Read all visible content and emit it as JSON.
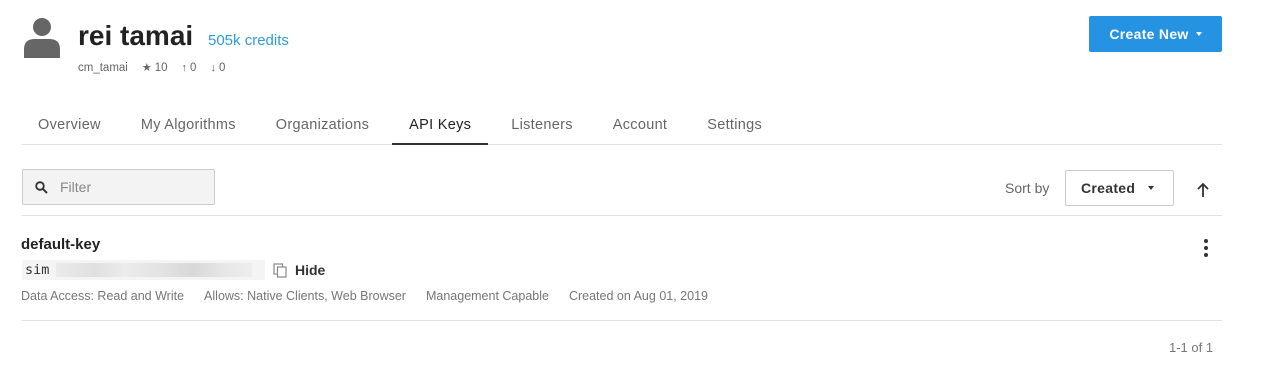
{
  "profile": {
    "name": "rei tamai",
    "credits": "505k credits",
    "username": "cm_tamai",
    "stars": "10",
    "up": "0",
    "down": "0"
  },
  "header": {
    "create_label": "Create New"
  },
  "tabs": [
    {
      "label": "Overview"
    },
    {
      "label": "My Algorithms"
    },
    {
      "label": "Organizations"
    },
    {
      "label": "API Keys",
      "active": true
    },
    {
      "label": "Listeners"
    },
    {
      "label": "Account"
    },
    {
      "label": "Settings"
    }
  ],
  "filter": {
    "placeholder": "Filter",
    "value": ""
  },
  "sort": {
    "label": "Sort by",
    "selected": "Created",
    "direction": "ascending"
  },
  "api_keys": [
    {
      "name": "default-key",
      "key_prefix": "sim",
      "hide_label": "Hide",
      "data_access": "Data Access: Read and Write",
      "allows": "Allows: Native Clients, Web Browser",
      "management": "Management Capable",
      "created": "Created on Aug 01, 2019"
    }
  ],
  "pagination": "1-1 of 1",
  "colors": {
    "accent": "#2593e2",
    "link": "#2d9be0"
  }
}
